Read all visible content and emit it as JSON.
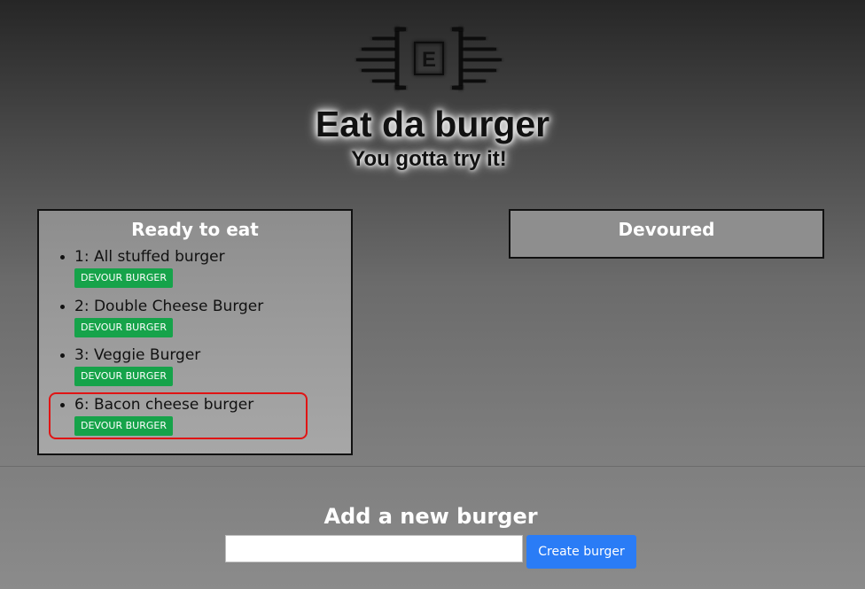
{
  "header": {
    "logo_letter": "E",
    "title": "Eat da burger",
    "tagline": "You gotta try it!"
  },
  "ready_panel": {
    "heading": "Ready to eat",
    "burgers": [
      {
        "id": "1",
        "name": "All stuffed burger",
        "button_label": "DEVOUR BURGER"
      },
      {
        "id": "2",
        "name": "Double Cheese Burger",
        "button_label": "DEVOUR BURGER"
      },
      {
        "id": "3",
        "name": "Veggie Burger",
        "button_label": "DEVOUR BURGER"
      },
      {
        "id": "6",
        "name": "Bacon cheese burger",
        "button_label": "DEVOUR BURGER"
      }
    ]
  },
  "devoured_panel": {
    "heading": "Devoured",
    "burgers": []
  },
  "add_form": {
    "heading": "Add a new burger",
    "input_value": "",
    "input_placeholder": "",
    "submit_label": "Create burger"
  },
  "colors": {
    "devour_button": "#16a34a",
    "create_button": "#2a7cf6",
    "highlight": "#e01414"
  }
}
